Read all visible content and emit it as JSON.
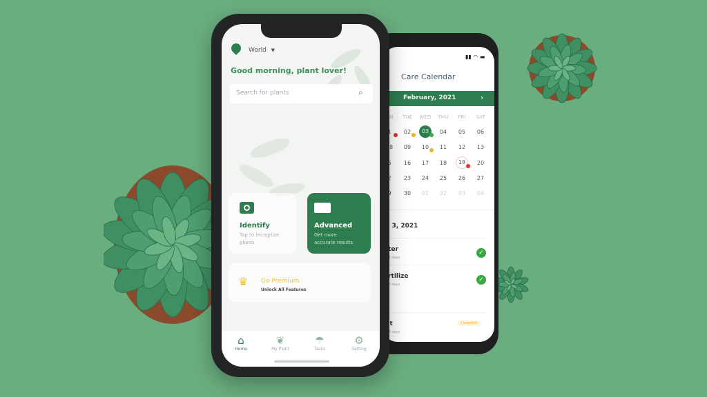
{
  "colors": {
    "background": "#6aae7f",
    "primary": "#2e7d4f",
    "premium": "#f2c230",
    "red": "#e0322b",
    "orange": "#f3b21c",
    "check": "#3aa845"
  },
  "home": {
    "location": "World",
    "greeting": "Good morning, plant lover!",
    "search_placeholder": "Search for plants",
    "identify": {
      "title": "Identify",
      "subtitle1": "Tap to recognize",
      "subtitle2": "plants"
    },
    "advanced": {
      "title": "Advanced",
      "subtitle1": "Get more",
      "subtitle2": "accurate results"
    },
    "premium": {
      "title": "Go Premium",
      "subtitle": "Unlock All Features"
    },
    "nav": [
      {
        "label": "Home",
        "icon": "home-icon"
      },
      {
        "label": "My Plant",
        "icon": "leaves-icon"
      },
      {
        "label": "Tasks",
        "icon": "watering-icon"
      },
      {
        "label": "Setting",
        "icon": "gear-icon"
      }
    ]
  },
  "calendar": {
    "title": "Care Calendar",
    "month": "February, 2021",
    "weekdays": [
      "ON",
      "TUE",
      "WED",
      "THU",
      "FRI",
      "SAT"
    ],
    "rows": [
      [
        "1",
        "02",
        "03",
        "04",
        "05",
        "06"
      ],
      [
        "08",
        "09",
        "10",
        "11",
        "12",
        "13"
      ],
      [
        "5",
        "16",
        "17",
        "18",
        "19",
        "20"
      ],
      [
        "2",
        "23",
        "24",
        "25",
        "26",
        "27"
      ],
      [
        "9",
        "30",
        "01",
        "02",
        "03",
        "04"
      ]
    ],
    "selected_date": "b 3, 2021",
    "tasks": [
      {
        "name": "ater",
        "detail": "ry 4 days",
        "done": true
      },
      {
        "name": "ertilize",
        "detail": "ry 7 days",
        "done": true
      },
      {
        "name": "ist",
        "detail": "ry 4 days",
        "badge": "Complete"
      }
    ]
  }
}
